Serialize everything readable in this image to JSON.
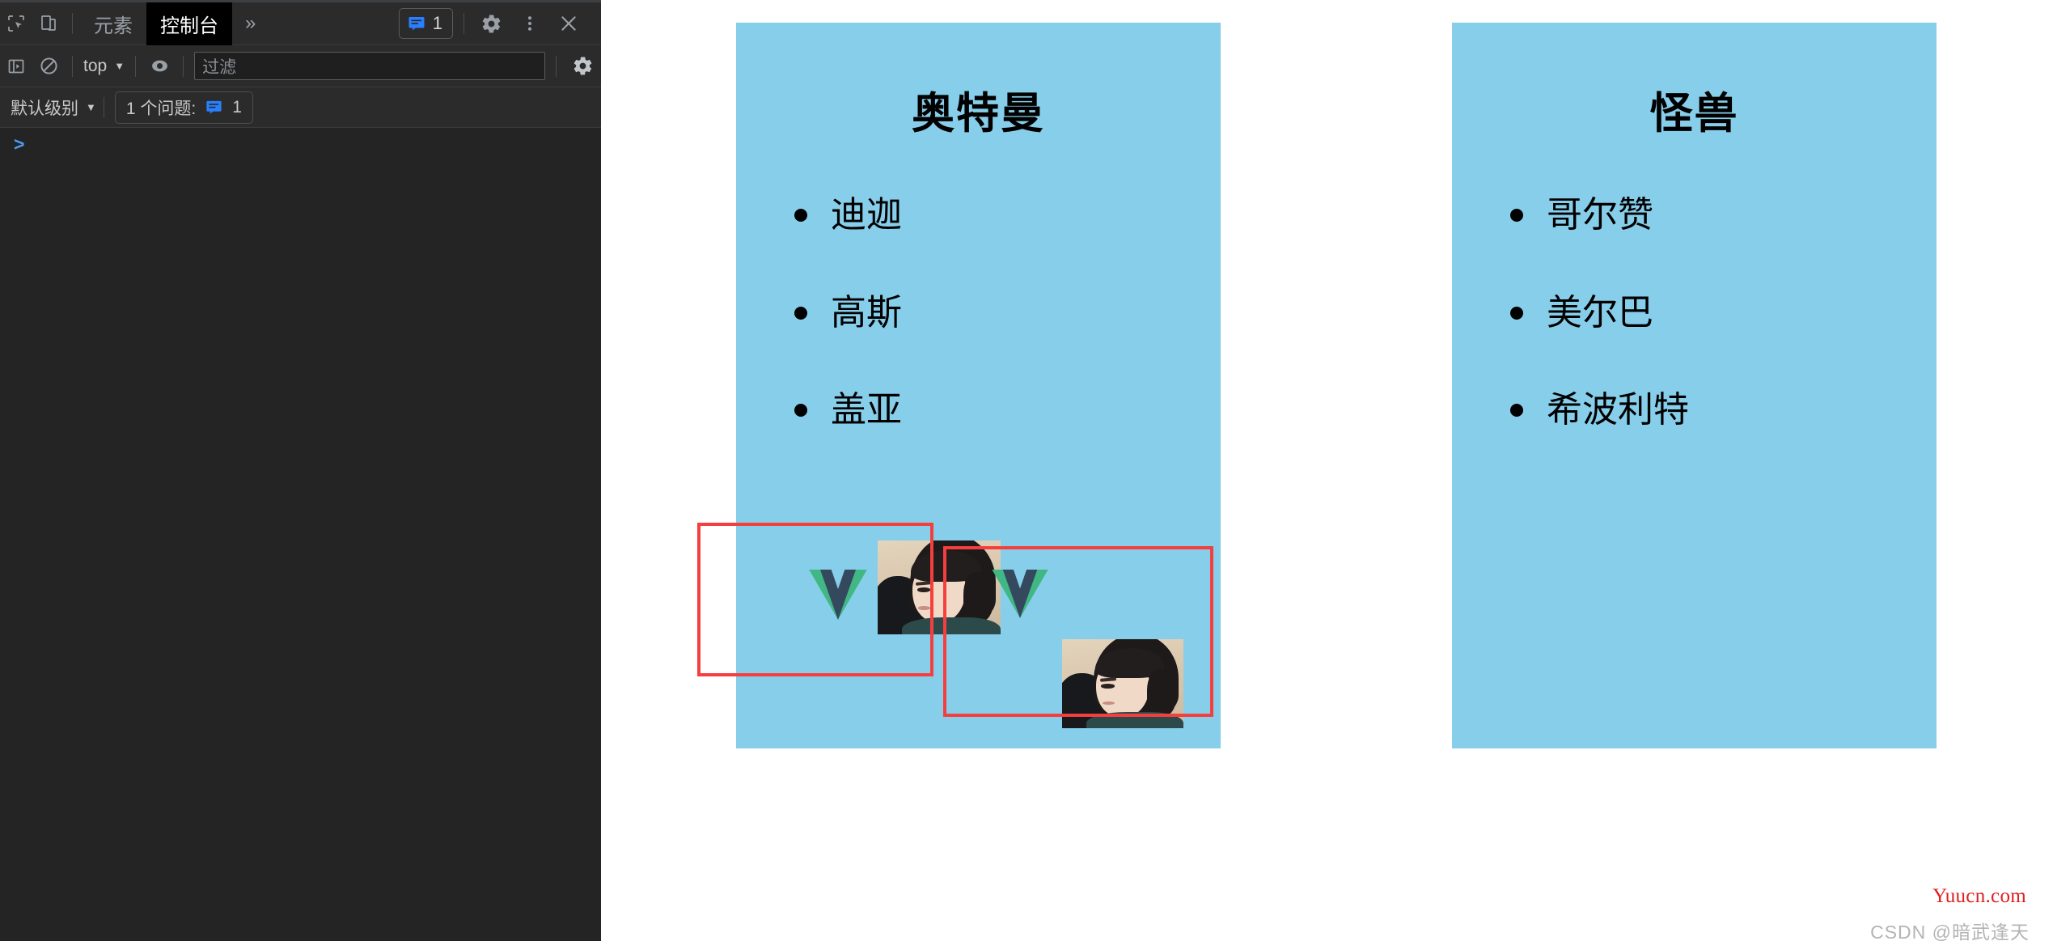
{
  "devtools": {
    "tabs": [
      {
        "label": "元素",
        "active": false
      },
      {
        "label": "控制台",
        "active": true
      }
    ],
    "more_tabs_icon": "chevron-double-right-icon",
    "inspect_icon": "inspect-element-icon",
    "device_icon": "device-toolbar-icon",
    "message_badge": {
      "icon": "message-icon",
      "count": "1"
    },
    "settings_icon": "gear-icon",
    "more_icon": "kebab-menu-icon",
    "close_icon": "close-icon",
    "toolbar2": {
      "sidebar_icon": "console-sidebar-icon",
      "clear_icon": "clear-console-icon",
      "context": "top",
      "context_caret": "▼",
      "eye_icon": "live-expression-icon",
      "filter_placeholder": "过滤",
      "settings_icon": "gear-icon"
    },
    "toolbar3": {
      "level": "默认级别",
      "level_caret": "▼",
      "issues_label": "1 个问题:",
      "issues_icon": "message-icon",
      "issues_count": "1"
    },
    "console_prompt": ">"
  },
  "page": {
    "cards": [
      {
        "title": "奥特曼",
        "items": [
          "迪迦",
          "高斯",
          "盖亚"
        ],
        "bg_color": "#87ceeb",
        "has_media": true,
        "media": [
          {
            "logo": "vue-logo-icon",
            "photo": "person-portrait-photo"
          },
          {
            "logo": "vue-logo-icon",
            "photo": "person-portrait-photo"
          }
        ]
      },
      {
        "title": "怪兽",
        "items": [
          "哥尔赞",
          "美尔巴",
          "希波利特"
        ],
        "bg_color": "#87ceeb",
        "has_media": false
      }
    ],
    "highlight_color": "#f53f3f"
  },
  "watermark": {
    "site": "Yuucn.com",
    "credit": "CSDN @暗武逢天",
    "site_color": "#e02020",
    "credit_color": "#b4b4b4"
  }
}
